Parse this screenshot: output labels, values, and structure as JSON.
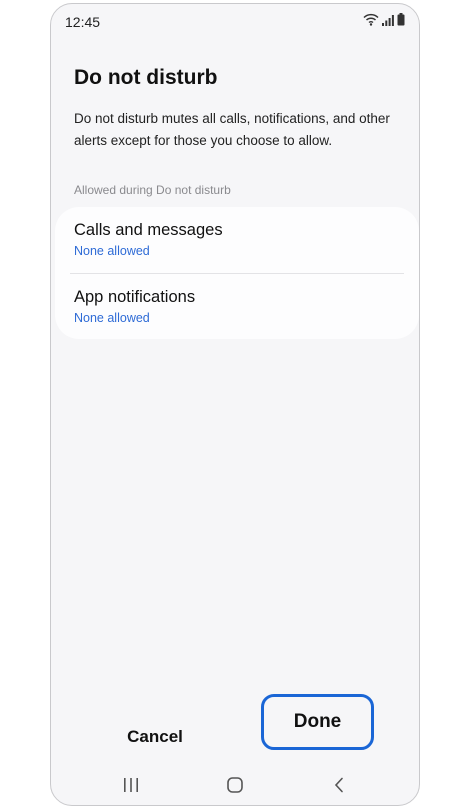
{
  "status_bar": {
    "time": "12:45",
    "icons": [
      "wifi-icon",
      "signal-icon",
      "battery-icon"
    ]
  },
  "page": {
    "title": "Do not disturb",
    "description": "Do not disturb mutes all calls, notifications, and other alerts except for those you choose to allow."
  },
  "section": {
    "header": "Allowed during Do not disturb",
    "items": [
      {
        "title": "Calls and messages",
        "subtitle": "None allowed"
      },
      {
        "title": "App notifications",
        "subtitle": "None allowed"
      }
    ]
  },
  "actions": {
    "cancel_label": "Cancel",
    "done_label": "Done"
  },
  "nav_bar": {
    "icons": [
      "recents-icon",
      "home-icon",
      "back-icon"
    ]
  },
  "colors": {
    "accent": "#2e6bd6",
    "highlight": "#1a66d6",
    "background": "#f6f6f8",
    "card": "#fdfdfe"
  }
}
